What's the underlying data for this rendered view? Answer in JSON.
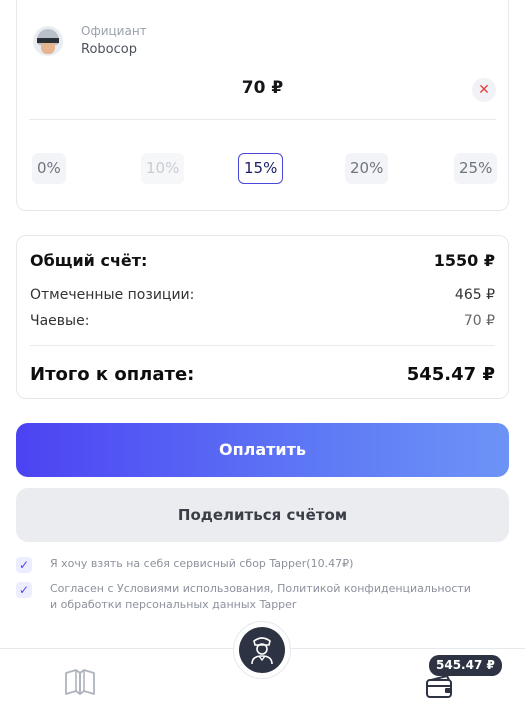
{
  "waiter": {
    "role": "Официант",
    "name": "Robocop"
  },
  "tip": {
    "amount": "70 ₽",
    "options": [
      "0%",
      "10%",
      "15%",
      "20%",
      "25%"
    ],
    "selected": "15%"
  },
  "summary": {
    "total_bill_label": "Общий счёт:",
    "total_bill_value": "1550 ₽",
    "marked_label": "Отмеченные позиции:",
    "marked_value": "465 ₽",
    "tips_label": "Чаевые:",
    "tips_value": "70 ₽",
    "to_pay_label": "Итого к оплате:",
    "to_pay_value": "545.47 ₽"
  },
  "actions": {
    "pay_label": "Оплатить",
    "share_label": "Поделиться счётом"
  },
  "consents": {
    "service_fee": "Я хочу взять на себя сервисный сбор Tapper(10.47₽)",
    "terms": "Согласен с Условиями использования, Политикой конфиденциальности и обработки персональных данных Tapper"
  },
  "bottom_nav": {
    "badge": "545.47 ₽",
    "icons": [
      "menu-book-icon",
      "waiter-icon",
      "wallet-icon"
    ]
  },
  "colors": {
    "accent": "#4c43f3",
    "accent_end": "#6d93f6",
    "dark": "#2d3342",
    "danger": "#e04444"
  }
}
